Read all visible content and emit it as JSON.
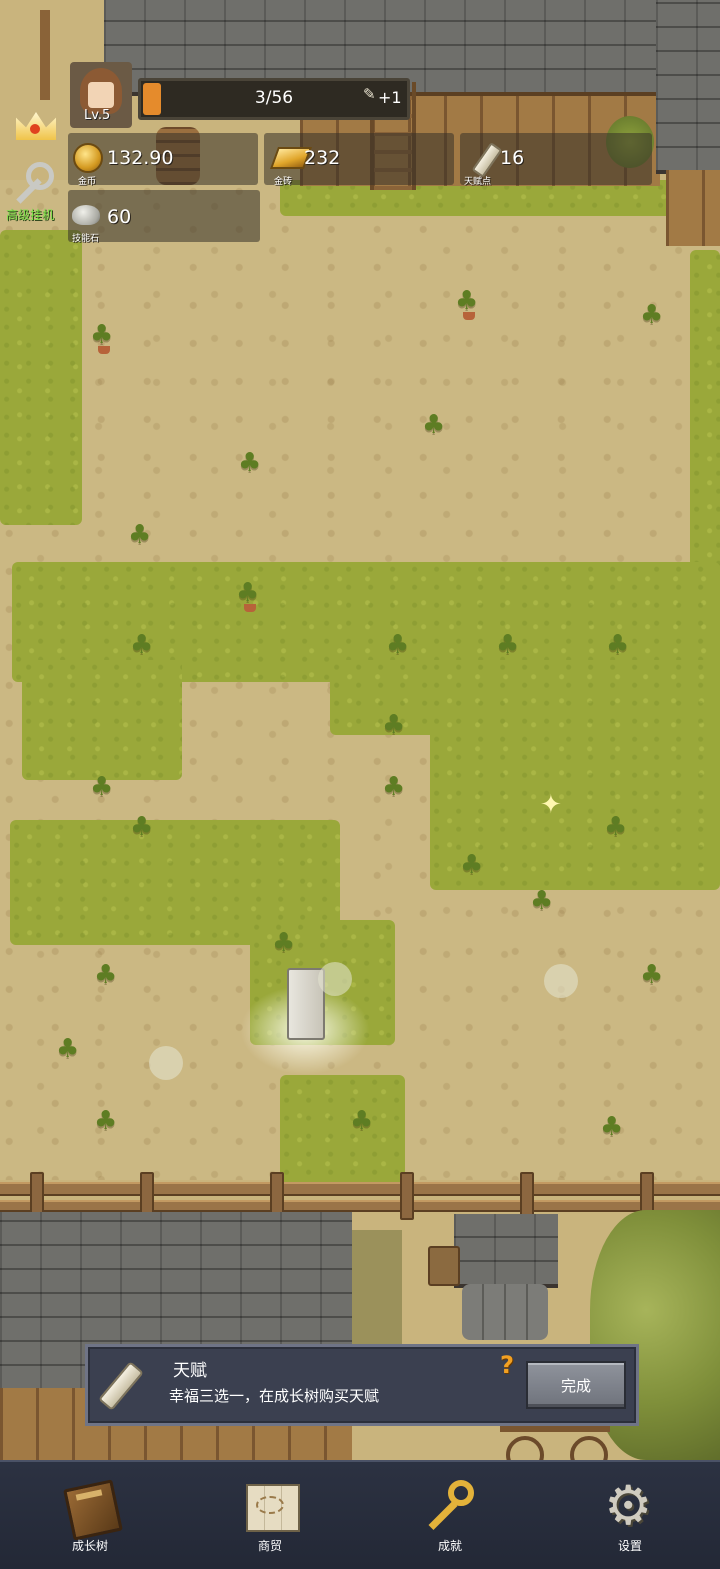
{
  "hud": {
    "level": "Lv.5",
    "progress": {
      "current": "3/56",
      "bonus": "+1",
      "fraction": 0.054
    },
    "resources": {
      "gold_coin": {
        "value": "132.90",
        "caption": "金币",
        "icon": "gold-coin-icon"
      },
      "gold_brick": {
        "value": "232",
        "caption": "金砖",
        "icon": "gold-brick-icon"
      },
      "talent_points": {
        "value": "16",
        "caption": "天赋点",
        "icon": "talent-scroll-icon"
      },
      "skill_stone": {
        "value": "60",
        "caption": "技能石",
        "icon": "skill-stone-icon"
      }
    },
    "idle_label": "高级挂机"
  },
  "talent_panel": {
    "title": "天赋",
    "description": "幸福三选一，在成长树购买天赋",
    "help": "?",
    "done_button": "完成"
  },
  "nav": [
    {
      "label": "成长树",
      "icon": "growth-tree-book-icon"
    },
    {
      "label": "商贸",
      "icon": "trade-map-icon"
    },
    {
      "label": "成就",
      "icon": "achievement-key-icon"
    },
    {
      "label": "设置",
      "icon": "settings-gear-icon"
    }
  ],
  "colors": {
    "grass": "#9aa83a",
    "dirt": "#cbb883",
    "panel": "#3b4050",
    "nav_bg": "#2c3242",
    "idle_text": "#7fe04a"
  }
}
